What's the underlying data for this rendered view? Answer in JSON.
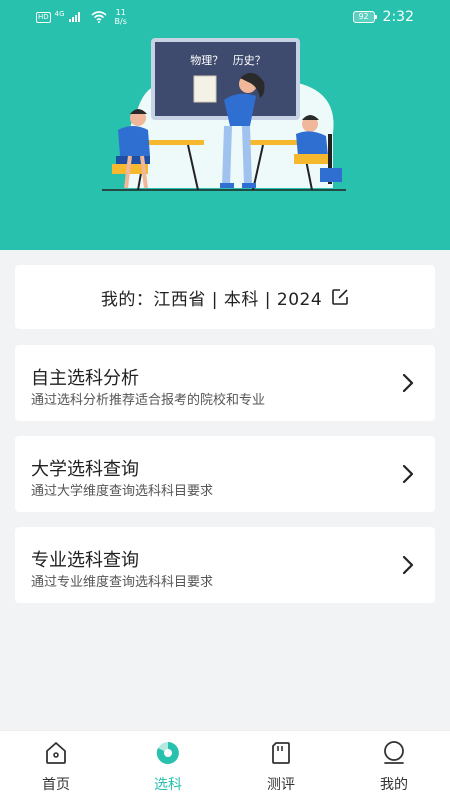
{
  "status_bar": {
    "hd": "HD",
    "signal_label": "4G",
    "net_speed_value": "11",
    "net_speed_unit": "B/s",
    "battery": "92",
    "time": "2:32"
  },
  "hero": {
    "board_text": "物理？ 历史？"
  },
  "profile": {
    "text": "我的：江西省 | 本科 | 2024"
  },
  "menu": [
    {
      "title": "自主选科分析",
      "subtitle": "通过选科分析推荐适合报考的院校和专业"
    },
    {
      "title": "大学选科查询",
      "subtitle": "通过大学维度查询选科科目要求"
    },
    {
      "title": "专业选科查询",
      "subtitle": "通过专业维度查询选科科目要求"
    }
  ],
  "tabs": [
    {
      "label": "首页",
      "icon": "home-icon"
    },
    {
      "label": "选科",
      "icon": "subject-select-icon",
      "active": true
    },
    {
      "label": "测评",
      "icon": "assessment-icon"
    },
    {
      "label": "我的",
      "icon": "profile-icon"
    }
  ],
  "colors": {
    "brand": "#27c1ad",
    "board": "#3f4b6e",
    "figure_blue": "#2f6fd1",
    "figure_yellow": "#f5b82e"
  }
}
